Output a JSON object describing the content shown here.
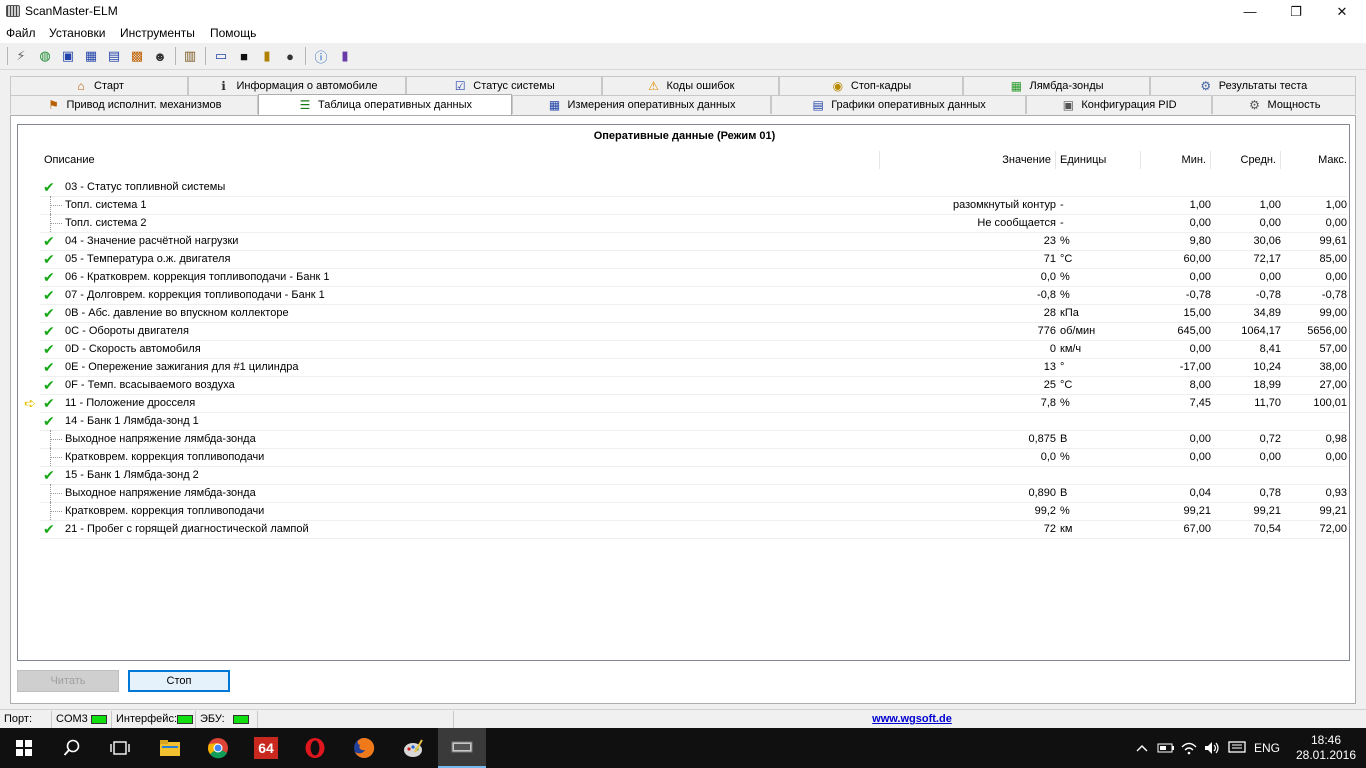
{
  "window": {
    "title": "ScanMaster-ELM",
    "controls": [
      "—",
      "❐",
      "✕"
    ]
  },
  "menu": [
    "Файл",
    "Установки",
    "Инструменты",
    "Помощь"
  ],
  "toolbar_icons": [
    "connect-icon",
    "globe-icon",
    "chip-icon",
    "table-icon",
    "chart-icon",
    "multi-chart-icon",
    "person-icon",
    "clipboard-icon",
    "monitor-icon",
    "terminal-icon",
    "battery-icon",
    "record-icon",
    "info-icon",
    "book-icon"
  ],
  "tabs_row1": [
    {
      "label": "Старт",
      "icon": "house-icon",
      "glyph": "⌂"
    },
    {
      "label": "Информация о автомобиле",
      "icon": "info-icon",
      "glyph": "ℹ"
    },
    {
      "label": "Статус системы",
      "icon": "checklist-icon",
      "glyph": "☑"
    },
    {
      "label": "Коды ошибок",
      "icon": "warning-icon",
      "glyph": "⚠"
    },
    {
      "label": "Стоп-кадры",
      "icon": "camera-icon",
      "glyph": "◉"
    },
    {
      "label": "Лямбда-зонды",
      "icon": "sensor-icon",
      "glyph": "▦"
    },
    {
      "label": "Результаты теста",
      "icon": "gear-icon",
      "glyph": "⚙"
    }
  ],
  "tabs_row2": [
    {
      "label": "Привод исполнит. механизмов",
      "icon": "actuator-icon",
      "glyph": "⚑"
    },
    {
      "label": "Таблица оперативных данных",
      "icon": "list-icon",
      "glyph": "☰"
    },
    {
      "label": "Измерения оперативных данных",
      "icon": "grid-icon",
      "glyph": "▦"
    },
    {
      "label": "Графики оперативных данных",
      "icon": "graph-icon",
      "glyph": "▤"
    },
    {
      "label": "Конфигурация PID",
      "icon": "chip-icon",
      "glyph": "▣"
    },
    {
      "label": "Мощность",
      "icon": "engine-icon",
      "glyph": "⚙"
    }
  ],
  "grid": {
    "title": "Оперативные данные (Режим 01)",
    "headers": {
      "desc": "Описание",
      "value": "Значение",
      "units": "Единицы",
      "min": "Мин.",
      "avg": "Средн.",
      "max": "Макс."
    },
    "rows": [
      {
        "level": 0,
        "desc": "03 - Статус топливной системы",
        "value": "",
        "units": "",
        "min": "",
        "avg": "",
        "max": ""
      },
      {
        "level": 1,
        "desc": "Топл. система 1",
        "value": "разомкнутый контур",
        "units": "-",
        "min": "1,00",
        "avg": "1,00",
        "max": "1,00"
      },
      {
        "level": 1,
        "desc": "Топл. система 2",
        "value": "Не сообщается",
        "units": "-",
        "min": "0,00",
        "avg": "0,00",
        "max": "0,00"
      },
      {
        "level": 0,
        "desc": "04 - Значение расчётной нагрузки",
        "value": "23",
        "units": "%",
        "min": "9,80",
        "avg": "30,06",
        "max": "99,61"
      },
      {
        "level": 0,
        "desc": "05 - Температура о.ж. двигателя",
        "value": "71",
        "units": "°C",
        "min": "60,00",
        "avg": "72,17",
        "max": "85,00"
      },
      {
        "level": 0,
        "desc": "06 - Кратковрем. коррекция топливоподачи - Банк 1",
        "value": "0,0",
        "units": "%",
        "min": "0,00",
        "avg": "0,00",
        "max": "0,00"
      },
      {
        "level": 0,
        "desc": "07 - Долговрем. коррекция топливоподачи - Банк 1",
        "value": "-0,8",
        "units": "%",
        "min": "-0,78",
        "avg": "-0,78",
        "max": "-0,78"
      },
      {
        "level": 0,
        "desc": "0B - Абс. давление во впускном коллекторе",
        "value": "28",
        "units": "кПа",
        "min": "15,00",
        "avg": "34,89",
        "max": "99,00"
      },
      {
        "level": 0,
        "desc": "0C - Обороты двигателя",
        "value": "776",
        "units": "об/мин",
        "min": "645,00",
        "avg": "1064,17",
        "max": "5656,00"
      },
      {
        "level": 0,
        "desc": "0D - Скорость автомобиля",
        "value": "0",
        "units": "км/ч",
        "min": "0,00",
        "avg": "8,41",
        "max": "57,00"
      },
      {
        "level": 0,
        "desc": "0E - Опережение зажигания для #1 цилиндра",
        "value": "13",
        "units": "°",
        "min": "-17,00",
        "avg": "10,24",
        "max": "38,00"
      },
      {
        "level": 0,
        "desc": "0F - Темп. всасываемого воздуха",
        "value": "25",
        "units": "°C",
        "min": "8,00",
        "avg": "18,99",
        "max": "27,00"
      },
      {
        "level": 0,
        "desc": "11 - Положение дросселя",
        "value": "7,8",
        "units": "%",
        "min": "7,45",
        "avg": "11,70",
        "max": "100,01"
      },
      {
        "level": 0,
        "desc": "14 - Банк 1 Лямбда-зонд 1",
        "value": "",
        "units": "",
        "min": "",
        "avg": "",
        "max": ""
      },
      {
        "level": 1,
        "desc": "Выходное напряжение лямбда-зонда",
        "value": "0,875",
        "units": "В",
        "min": "0,00",
        "avg": "0,72",
        "max": "0,98"
      },
      {
        "level": 1,
        "desc": "Кратковрем. коррекция топливоподачи",
        "value": "0,0",
        "units": "%",
        "min": "0,00",
        "avg": "0,00",
        "max": "0,00"
      },
      {
        "level": 0,
        "desc": "15 - Банк 1 Лямбда-зонд 2",
        "value": "",
        "units": "",
        "min": "",
        "avg": "",
        "max": ""
      },
      {
        "level": 1,
        "desc": "Выходное напряжение лямбда-зонда",
        "value": "0,890",
        "units": "В",
        "min": "0,04",
        "avg": "0,78",
        "max": "0,93"
      },
      {
        "level": 1,
        "desc": "Кратковрем. коррекция топливоподачи",
        "value": "99,2",
        "units": "%",
        "min": "99,21",
        "avg": "99,21",
        "max": "99,21"
      },
      {
        "level": 0,
        "desc": "21 - Пробег с горящей диагностической лампой",
        "value": "72",
        "units": "км",
        "min": "67,00",
        "avg": "70,54",
        "max": "72,00"
      }
    ]
  },
  "buttons": {
    "read": "Читать",
    "stop": "Стоп"
  },
  "status": {
    "port_label": "Порт:",
    "port_value": "COM3",
    "interface_label": "Интерфейс:",
    "ecu_label": "ЭБУ:",
    "link": "www.wgsoft.de",
    "led_color": "#10e010"
  },
  "taskbar": {
    "time": "18:46",
    "date": "28.01.2016",
    "lang": "ENG",
    "badge_64": "64"
  }
}
